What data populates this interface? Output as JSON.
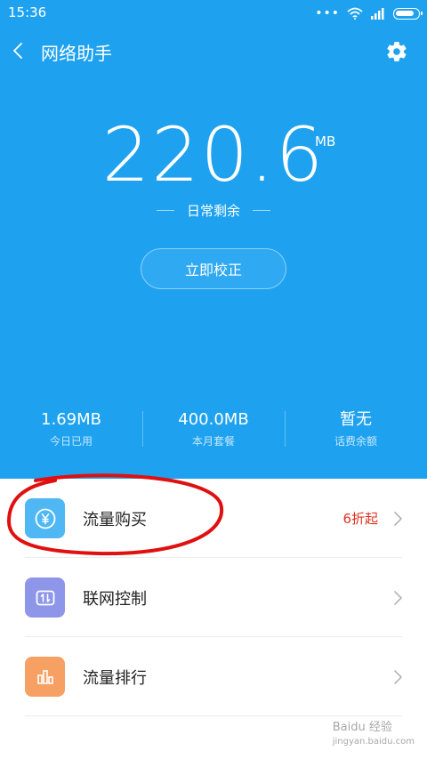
{
  "status_bar": {
    "time": "15:36",
    "dots": "•••"
  },
  "header": {
    "title": "网络助手"
  },
  "main": {
    "value": "220.6",
    "unit": "MB",
    "subtitle": "日常剩余",
    "calibrate_label": "立即校正"
  },
  "stats": [
    {
      "value": "1.69MB",
      "label": "今日已用"
    },
    {
      "value": "400.0MB",
      "label": "本月套餐"
    },
    {
      "value": "暂无",
      "label": "话费余额"
    }
  ],
  "list": [
    {
      "label": "流量购买",
      "badge": "6折起",
      "icon": "yen-coin-icon",
      "icon_color": "#4fb8f4"
    },
    {
      "label": "联网控制",
      "badge": "",
      "icon": "network-toggle-icon",
      "icon_color": "#8e96ea"
    },
    {
      "label": "流量排行",
      "badge": "",
      "icon": "bar-chart-icon",
      "icon_color": "#f6a064"
    }
  ],
  "colors": {
    "accent": "#1ea2f0",
    "badge": "#e0321e",
    "annotation": "#e01010"
  },
  "watermark": {
    "text": "Baidu 经验",
    "subtext": "jingyan.baidu.com"
  }
}
